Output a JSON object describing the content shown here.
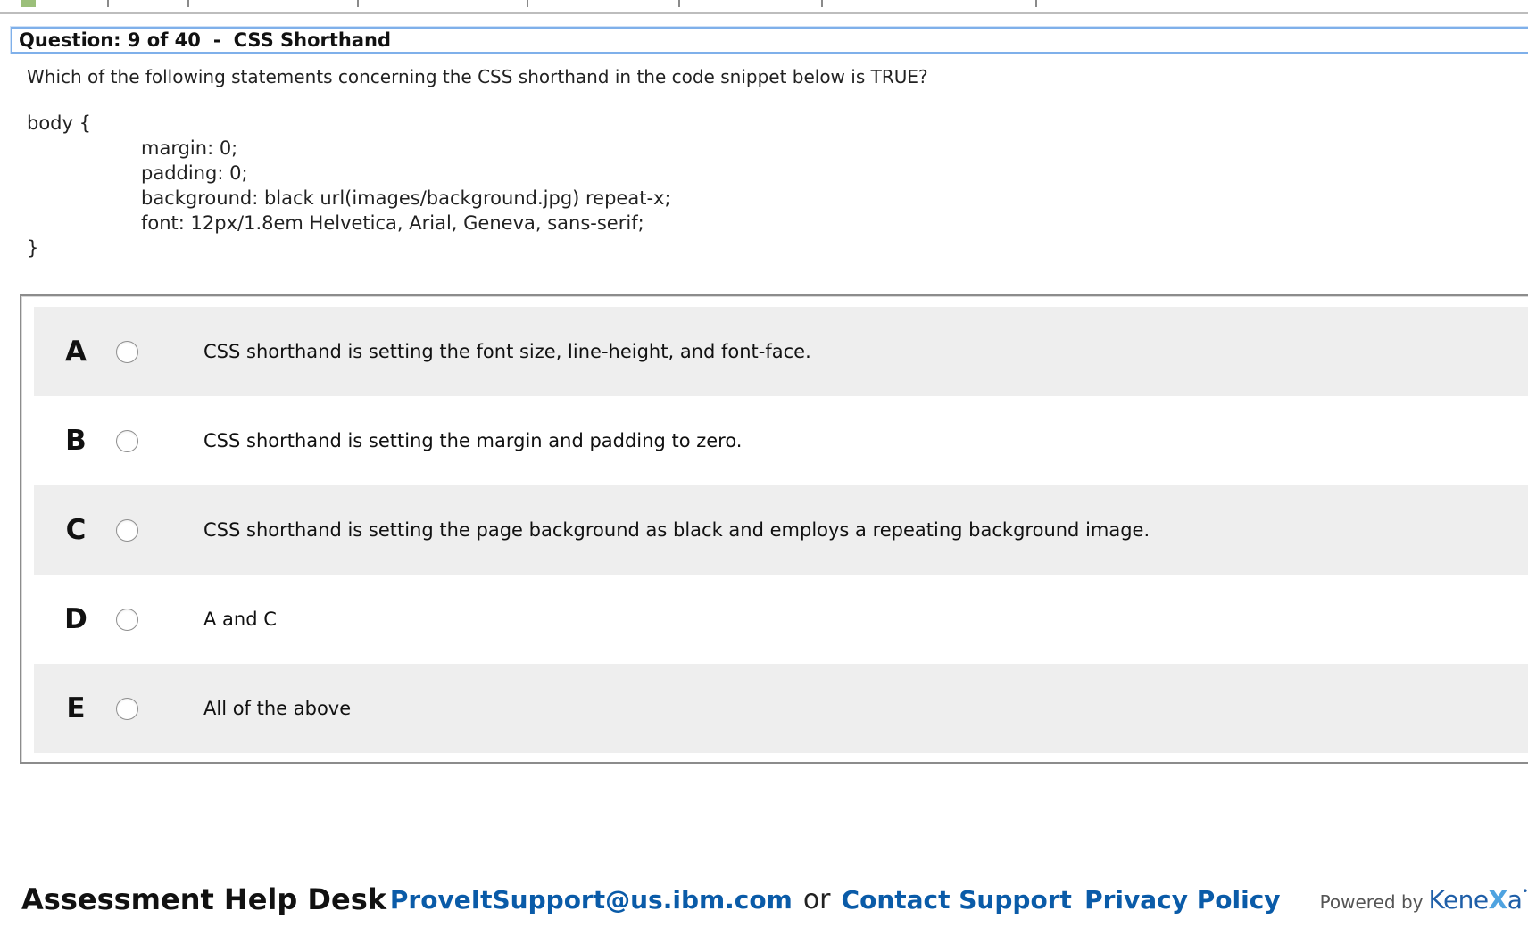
{
  "question": {
    "counter": "Question: 9 of 40",
    "separator": "-",
    "topic": "CSS Shorthand",
    "text": "Which of the following statements concerning the CSS shorthand in the code snippet below is TRUE?"
  },
  "code": {
    "open": "body {",
    "lines": [
      "margin: 0;",
      "padding: 0;",
      "background: black url(images/background.jpg) repeat-x;",
      "font: 12px/1.8em Helvetica, Arial, Geneva, sans-serif;"
    ],
    "close": "}"
  },
  "answers": [
    {
      "letter": "A",
      "text": "CSS shorthand is setting the font size, line-height, and font-face."
    },
    {
      "letter": "B",
      "text": "CSS shorthand is setting the margin and padding to zero."
    },
    {
      "letter": "C",
      "text": "CSS shorthand is setting the page background as black and employs a repeating background image."
    },
    {
      "letter": "D",
      "text": "A and C"
    },
    {
      "letter": "E",
      "text": "All of the above"
    }
  ],
  "footer": {
    "helpdesk": "Assessment Help Desk",
    "email": "ProveItSupport@us.ibm.com",
    "or": "or",
    "contact": "Contact Support",
    "privacy": "Privacy Policy",
    "powered_by": "Powered by",
    "brand_main": "Kene",
    "brand_accent": "X",
    "brand_tail": "a"
  },
  "colors": {
    "link": "#0a5ba8",
    "question_bar_border": "#7fb0ea",
    "shaded_row": "#eeeeee"
  }
}
